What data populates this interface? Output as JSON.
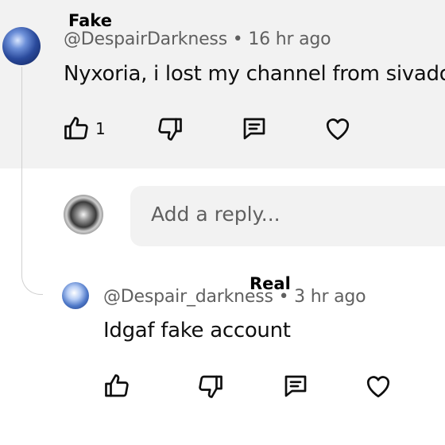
{
  "annotations": {
    "fake_label": "Fake",
    "real_label": "Real"
  },
  "top_comment": {
    "handle": "@DespairDarkness",
    "separator": "•",
    "time": "16 hr ago",
    "text": "Nyxoria, i lost my channel from sivado",
    "like_count": "1"
  },
  "reply_input": {
    "placeholder": "Add a reply..."
  },
  "reply": {
    "handle": "@Despair_darkness",
    "separator": "•",
    "time": "3 hr ago",
    "text": "Idgaf fake account"
  },
  "icons": {
    "like": "thumbs-up-icon",
    "dislike": "thumbs-down-icon",
    "reply": "comment-icon",
    "heart": "heart-icon"
  }
}
